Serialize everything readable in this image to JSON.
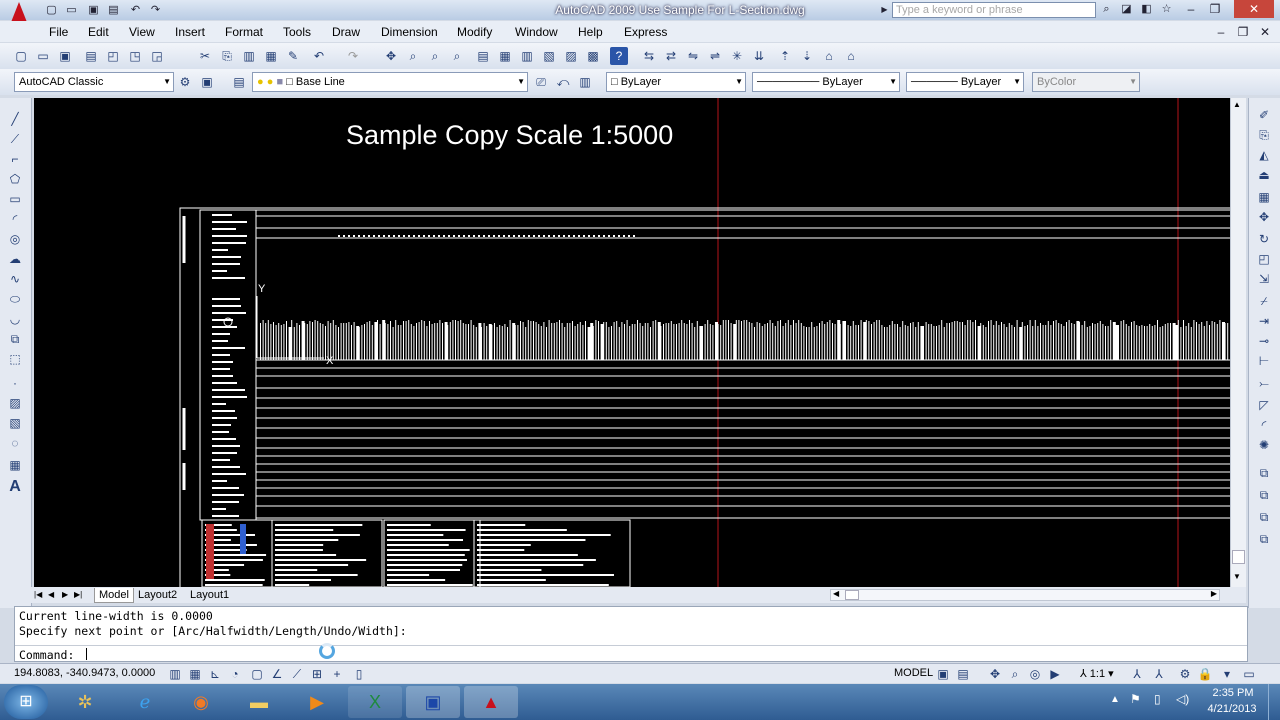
{
  "window": {
    "title": "AutoCAD 2009 Use Sample For L-Section.dwg",
    "search_placeholder": "Type a keyword or phrase",
    "logo_letter": "A"
  },
  "menu": [
    "File",
    "Edit",
    "View",
    "Insert",
    "Format",
    "Tools",
    "Draw",
    "Dimension",
    "Modify",
    "Window",
    "Help",
    "Express"
  ],
  "toolbar2": {
    "workspace": "AutoCAD Classic",
    "layer": "Base Line",
    "color": "ByLayer",
    "linetype": "ByLayer",
    "lineweight": "ByLayer",
    "plotstyle": "ByColor"
  },
  "drawing": {
    "title": "Sample Copy Scale 1:5000",
    "ucs_y": "Y",
    "ucs_x": "X"
  },
  "tabs": [
    "Model",
    "Layout2",
    "Layout1"
  ],
  "command": {
    "line1": "Current line-width is 0.0000",
    "line2": "Specify next point or [Arc/Halfwidth/Length/Undo/Width]:",
    "prompt": "Command:"
  },
  "status": {
    "coords": "194.8083, -340.9473, 0.0000",
    "space": "MODEL",
    "scale": "1:1"
  },
  "taskbar": {
    "time": "2:35 PM",
    "date": "4/21/2013"
  },
  "colors": {
    "red_line": "#b5141a",
    "canvas": "#000000"
  }
}
